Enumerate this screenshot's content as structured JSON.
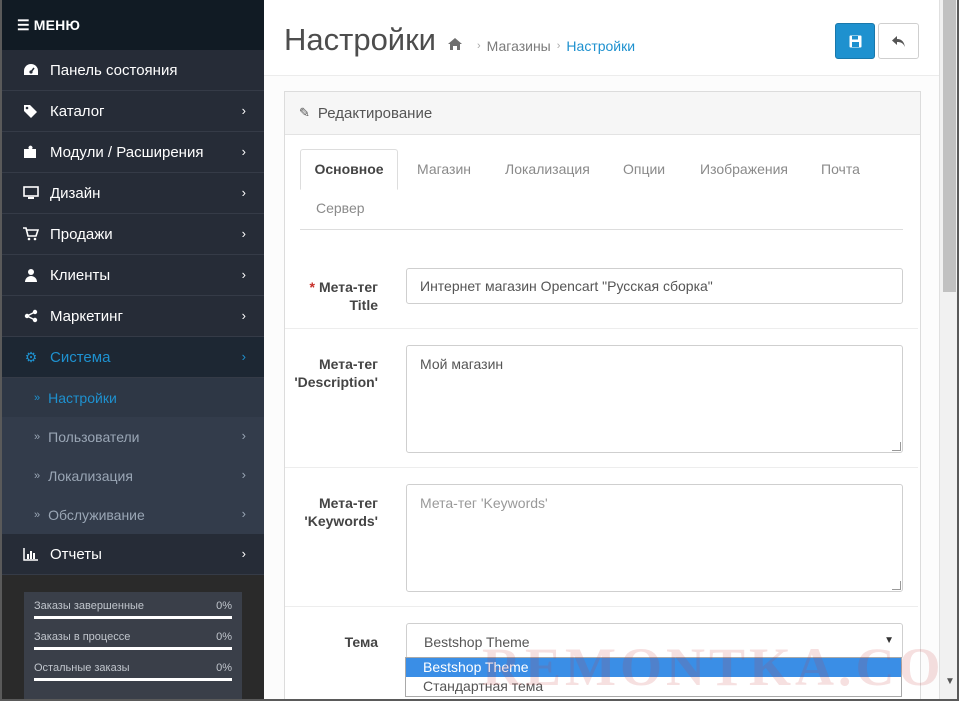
{
  "sidebar": {
    "menu_label": "МЕНЮ",
    "items": [
      {
        "label": "Панель состояния",
        "icon": "dashboard-icon"
      },
      {
        "label": "Каталог",
        "icon": "tags-icon"
      },
      {
        "label": "Модули / Расширения",
        "icon": "puzzle-icon"
      },
      {
        "label": "Дизайн",
        "icon": "monitor-icon"
      },
      {
        "label": "Продажи",
        "icon": "cart-icon"
      },
      {
        "label": "Клиенты",
        "icon": "user-icon"
      },
      {
        "label": "Маркетинг",
        "icon": "share-icon"
      },
      {
        "label": "Система",
        "icon": "gear-icon"
      }
    ],
    "subitems": [
      {
        "label": "Настройки"
      },
      {
        "label": "Пользователи"
      },
      {
        "label": "Локализация"
      },
      {
        "label": "Обслуживание"
      }
    ],
    "reports": {
      "label": "Отчеты",
      "icon": "bar-chart-icon"
    },
    "stats": [
      {
        "label": "Заказы завершенные",
        "value": "0%"
      },
      {
        "label": "Заказы в процессе",
        "value": "0%"
      },
      {
        "label": "Остальные заказы",
        "value": "0%"
      }
    ]
  },
  "header": {
    "title": "Настройки",
    "breadcrumbs": [
      "Магазины",
      "Настройки"
    ]
  },
  "panel": {
    "title": "Редактирование",
    "tabs": [
      "Основное",
      "Магазин",
      "Локализация",
      "Опции",
      "Изображения",
      "Почта",
      "Сервер"
    ]
  },
  "form": {
    "meta_title_label_1": "Мета-тег",
    "meta_title_label_2": "Title",
    "meta_title_value": "Интернет магазин Opencart \"Русская сборка\"",
    "meta_description_label_1": "Мета-тег",
    "meta_description_label_2": "'Description'",
    "meta_description_value": "Мой магазин",
    "meta_keywords_label_1": "Мета-тег",
    "meta_keywords_label_2": "'Keywords'",
    "meta_keywords_placeholder": "Мета-тег 'Keywords'",
    "theme_label": "Тема",
    "theme_value": "Bestshop Theme",
    "theme_options": [
      "Bestshop Theme",
      "Стандартная тема"
    ]
  },
  "watermark": "REMONTKA.COM",
  "colors": {
    "accent": "#1e91cf",
    "sidebar": "#262c37",
    "required": "#c72f29",
    "dropdown_selected": "#3a8ee6"
  }
}
